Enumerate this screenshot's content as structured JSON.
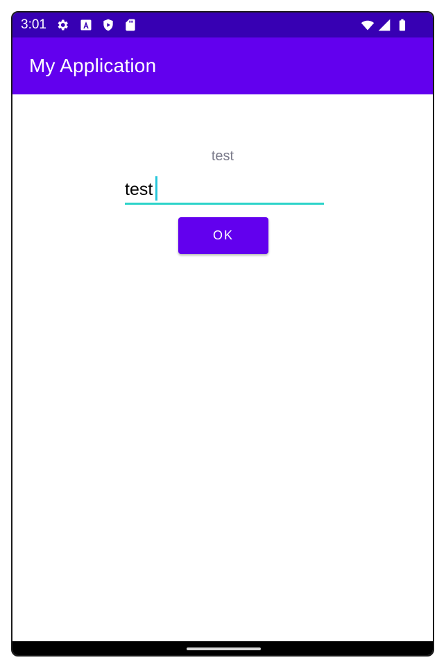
{
  "status_bar": {
    "time": "3:01",
    "left_icons": [
      "settings-icon",
      "font-icon",
      "shield-play-icon",
      "sd-card-icon"
    ],
    "right_icons": [
      "wifi-icon",
      "cell-signal-icon",
      "battery-icon"
    ]
  },
  "app_bar": {
    "title": "My Application"
  },
  "main": {
    "label": "test",
    "input": {
      "value": "test",
      "placeholder": ""
    },
    "ok_button_label": "OK"
  },
  "colors": {
    "status_bar": "#3700b3",
    "primary": "#6200ee",
    "accent": "#2bd3c9",
    "label_text": "#7a7a8a"
  }
}
